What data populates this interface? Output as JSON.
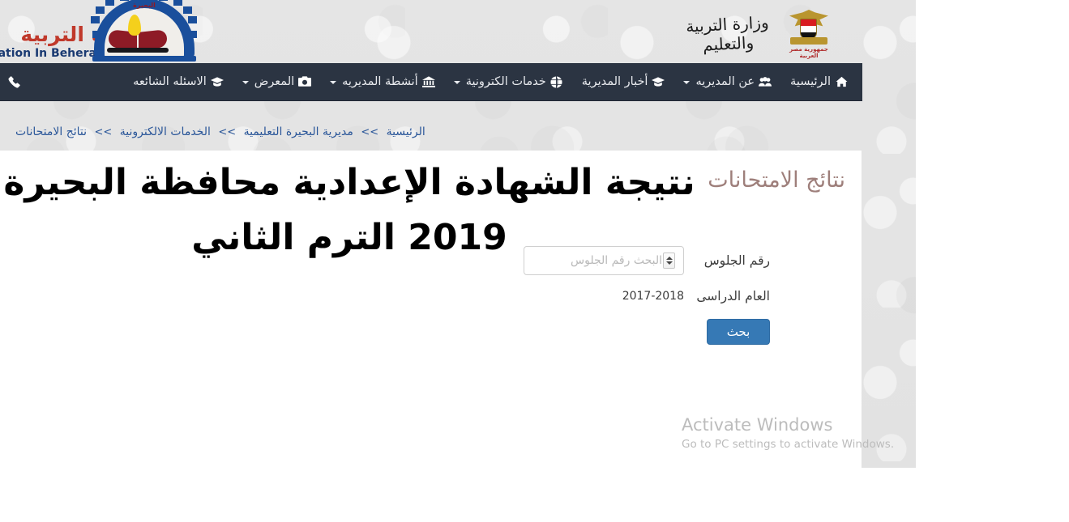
{
  "site": {
    "header": {
      "logo_caption": "البحيرة",
      "arabic_title": "مديرية التربية",
      "english_title": "Education In Behera",
      "ministry_title": "وزارة التربية والتعليم",
      "emblem_caption": "جمهورية مصر العربية"
    },
    "navbar": {
      "items": [
        {
          "label": "الرئيسية",
          "icon": "home-icon",
          "caret": false
        },
        {
          "label": "عن المديريه",
          "icon": "users-icon",
          "caret": true
        },
        {
          "label": "أخبار المديرية",
          "icon": "graduation-cap-icon",
          "caret": false
        },
        {
          "label": "خدمات الكترونية",
          "icon": "globe-icon",
          "caret": true
        },
        {
          "label": "أنشطة المديريه",
          "icon": "bank-icon",
          "caret": true
        },
        {
          "label": "المعرض",
          "icon": "camera-icon",
          "caret": true
        },
        {
          "label": "الاسئله الشائعه",
          "icon": "graduation-cap-icon",
          "caret": false
        }
      ],
      "phone_icon": "phone-icon"
    },
    "breadcrumb": {
      "items": [
        "الرئيسية",
        "مديرية البحيرة التعليمية",
        "الخدمات الالكترونية",
        "نتائج الامتحانات"
      ],
      "separator": ">>"
    },
    "page": {
      "title": "نتائج الامتحانات",
      "form": {
        "seat_label": "رقم الجلوس",
        "seat_placeholder": "البحث رقم الجلوس",
        "seat_value": "",
        "year_label": "العام الدراسى",
        "year_value": "2017-2018",
        "search_button": "بحث"
      }
    },
    "colors": {
      "navbar_bg": "#2b3442",
      "link_blue": "#2a5699",
      "button_blue": "#3679b5",
      "title_mauve": "#9e7f7b",
      "brand_red": "#c0392b"
    }
  },
  "overlay": {
    "headline_line1": "نتيجة الشهادة الإعدادية محافظة البحيرة",
    "headline_line2": "2019 الترم الثاني"
  },
  "watermark": {
    "title": "Activate Windows",
    "subtitle": "Go to PC settings to activate Windows."
  }
}
